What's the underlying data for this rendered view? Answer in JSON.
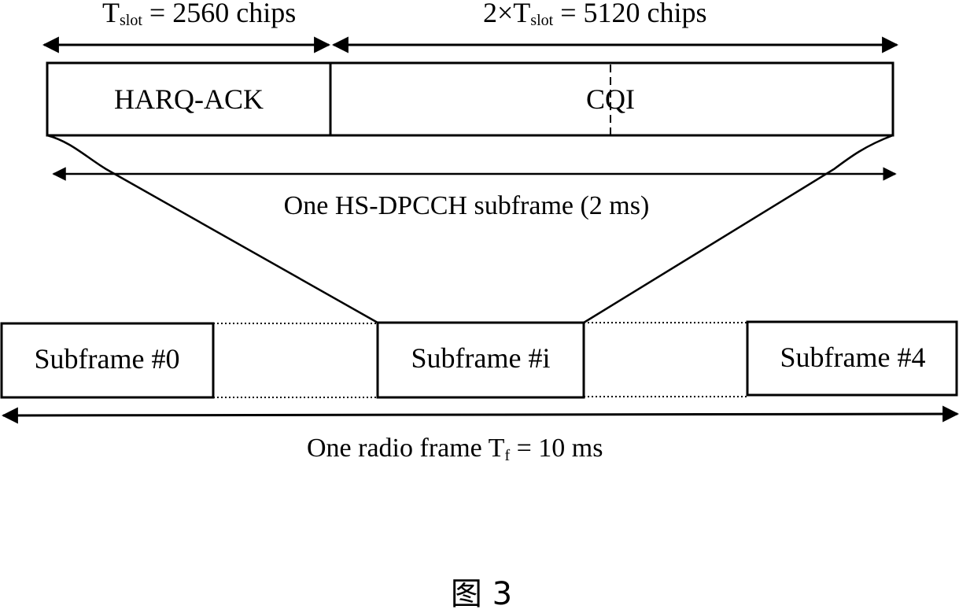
{
  "diagram": {
    "top_labels": {
      "slot": {
        "main": "T",
        "subscript": "slot",
        "rest": " = 2560 chips"
      },
      "double_slot": {
        "prefix": "2×T",
        "subscript": "slot",
        "rest": " = 5120 chips"
      }
    },
    "subframe_fields": {
      "harq": "HARQ-ACK",
      "cqi": "CQI"
    },
    "subframe_caption": "One HS-DPCCH subframe (2 ms)",
    "radio_frame": {
      "subframes": [
        "Subframe #0",
        "Subframe #i",
        "Subframe #4"
      ],
      "caption": {
        "prefix": "One radio frame T",
        "subscript": "f",
        "rest": " = 10 ms"
      }
    },
    "figure_label": "图 3"
  },
  "colors": {
    "line": "#000000",
    "background": "#ffffff"
  }
}
